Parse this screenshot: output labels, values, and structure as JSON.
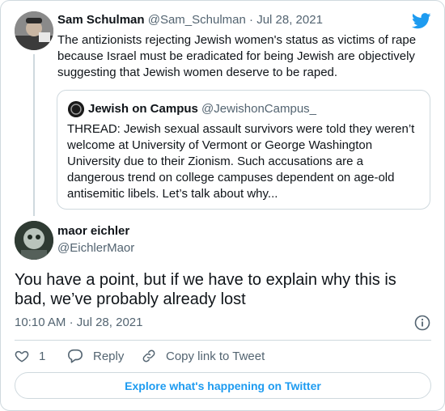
{
  "brand_color": "#1d9bf0",
  "quoted_parent": {
    "name": "Sam Schulman",
    "handle": "@Sam_Schulman",
    "separator": "·",
    "date": "Jul 28, 2021",
    "text": "The antizionists rejecting Jewish women's status as victims of rape because Israel must be eradicated for being Jewish are objectively suggesting that Jewish women deserve to be raped.",
    "logo_icon": "twitter-bird-icon"
  },
  "quoted_tweet": {
    "name": "Jewish on Campus",
    "handle": "@JewishonCampus_",
    "text": "THREAD: Jewish sexual assault survivors were told they weren’t welcome at University of Vermont or George Washington University due to their Zionism. Such accusations are a dangerous trend on college campuses dependent on age-old antisemitic libels. Let’s talk about why..."
  },
  "reply_tweet": {
    "name": "maor eichler",
    "handle": "@EichlerMaor",
    "text": "You have a point, but if we have to explain why this is bad, we’ve probably already lost",
    "time": "10:10 AM",
    "separator": "·",
    "date": "Jul 28, 2021"
  },
  "actions": {
    "like_count": "1",
    "reply_label": "Reply",
    "copy_link_label": "Copy link to Tweet"
  },
  "explore_label": "Explore what's happening on Twitter"
}
